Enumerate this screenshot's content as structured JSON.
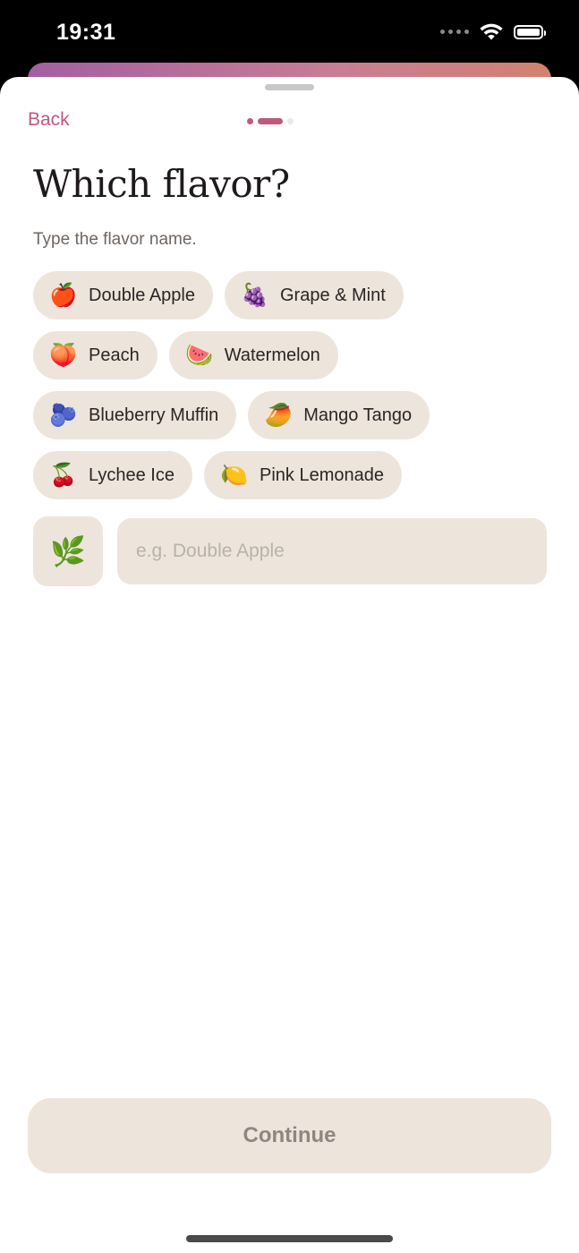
{
  "status_bar": {
    "time": "19:31",
    "icons": [
      "signal-icon",
      "wifi-icon",
      "battery-icon"
    ]
  },
  "header": {
    "back_label": "Back",
    "progress": {
      "step": 2,
      "total": 3
    }
  },
  "title": "Which flavor?",
  "subtitle": "Type the flavor name.",
  "flavors": [
    {
      "emoji": "🍎",
      "label": "Double Apple"
    },
    {
      "emoji": "🍇",
      "label": "Grape & Mint"
    },
    {
      "emoji": "🍑",
      "label": "Peach"
    },
    {
      "emoji": "🍉",
      "label": "Watermelon"
    },
    {
      "emoji": "🫐",
      "label": "Blueberry Muffin"
    },
    {
      "emoji": "🥭",
      "label": "Mango Tango"
    },
    {
      "emoji": "🍒",
      "label": "Lychee Ice"
    },
    {
      "emoji": "🍋",
      "label": "Pink Lemonade"
    }
  ],
  "custom_input": {
    "icon": "🌿",
    "placeholder": "e.g. Double Apple",
    "value": ""
  },
  "continue_label": "Continue",
  "colors": {
    "accent": "#c0587e",
    "chip_bg": "#ede5db"
  }
}
